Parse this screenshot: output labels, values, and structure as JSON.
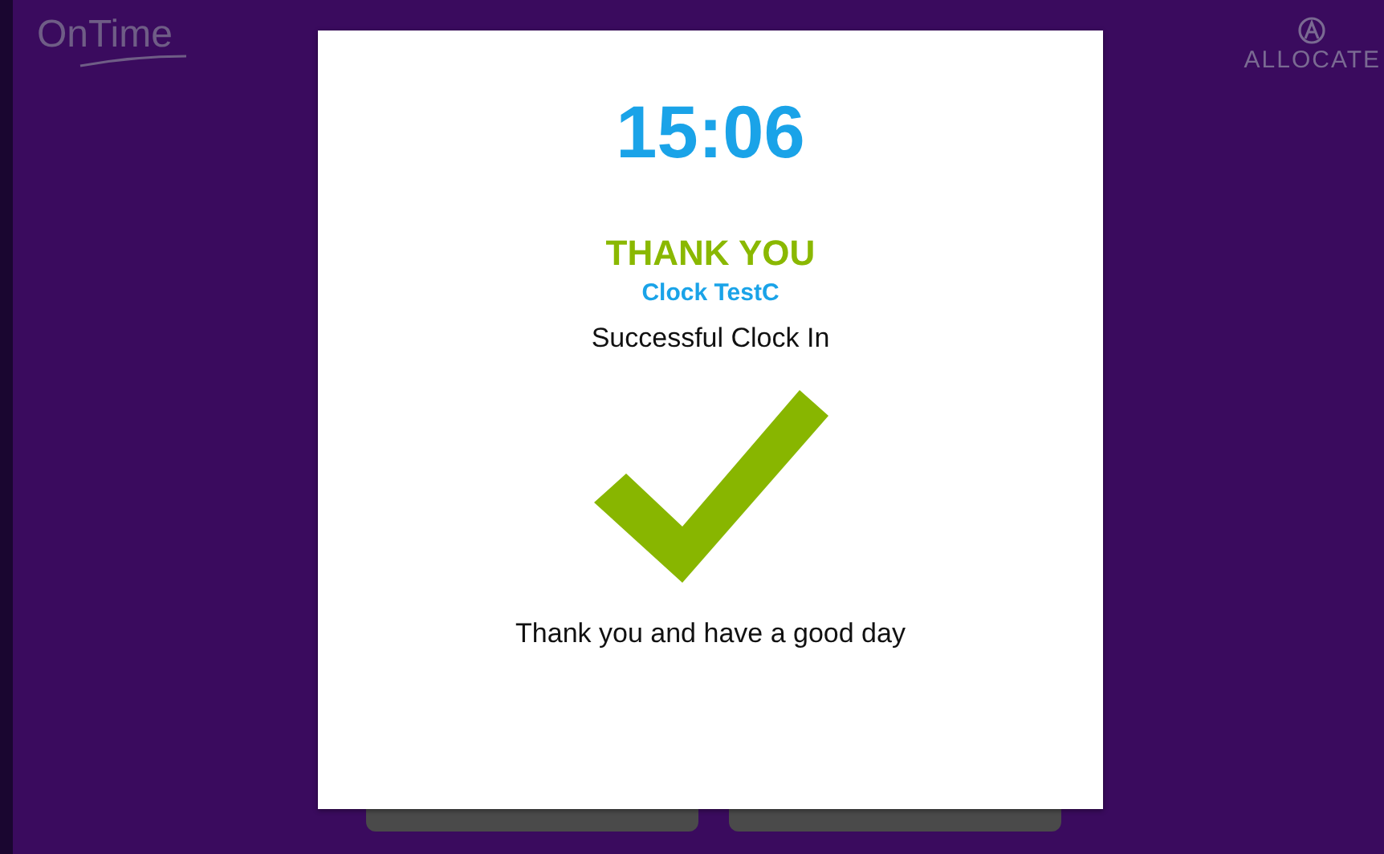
{
  "header": {
    "left_logo": "OnTime",
    "right_logo": "ALLOCATE"
  },
  "dialog": {
    "time": "15:06",
    "heading": "THANK YOU",
    "name": "Clock TestC",
    "status": "Successful Clock In",
    "message": "Thank you and have a good day"
  },
  "background_buttons": [
    {
      "kind": "button"
    },
    {
      "kind": "button"
    }
  ]
}
